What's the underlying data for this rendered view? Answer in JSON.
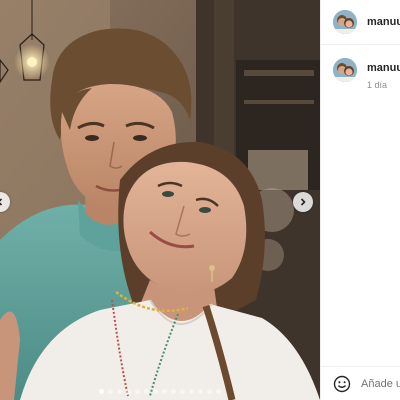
{
  "post": {
    "photo_alt": "selfie-photo",
    "carousel": {
      "dot_count": 14,
      "active_index": 0
    }
  },
  "header": {
    "username": "manuu"
  },
  "comment": {
    "username": "manuu",
    "time": "1 día"
  },
  "add_comment": {
    "placeholder": "Añade u"
  },
  "icons": {
    "next": "chevron-right-icon",
    "prev": "chevron-left-icon",
    "emoji": "smiley-icon"
  }
}
